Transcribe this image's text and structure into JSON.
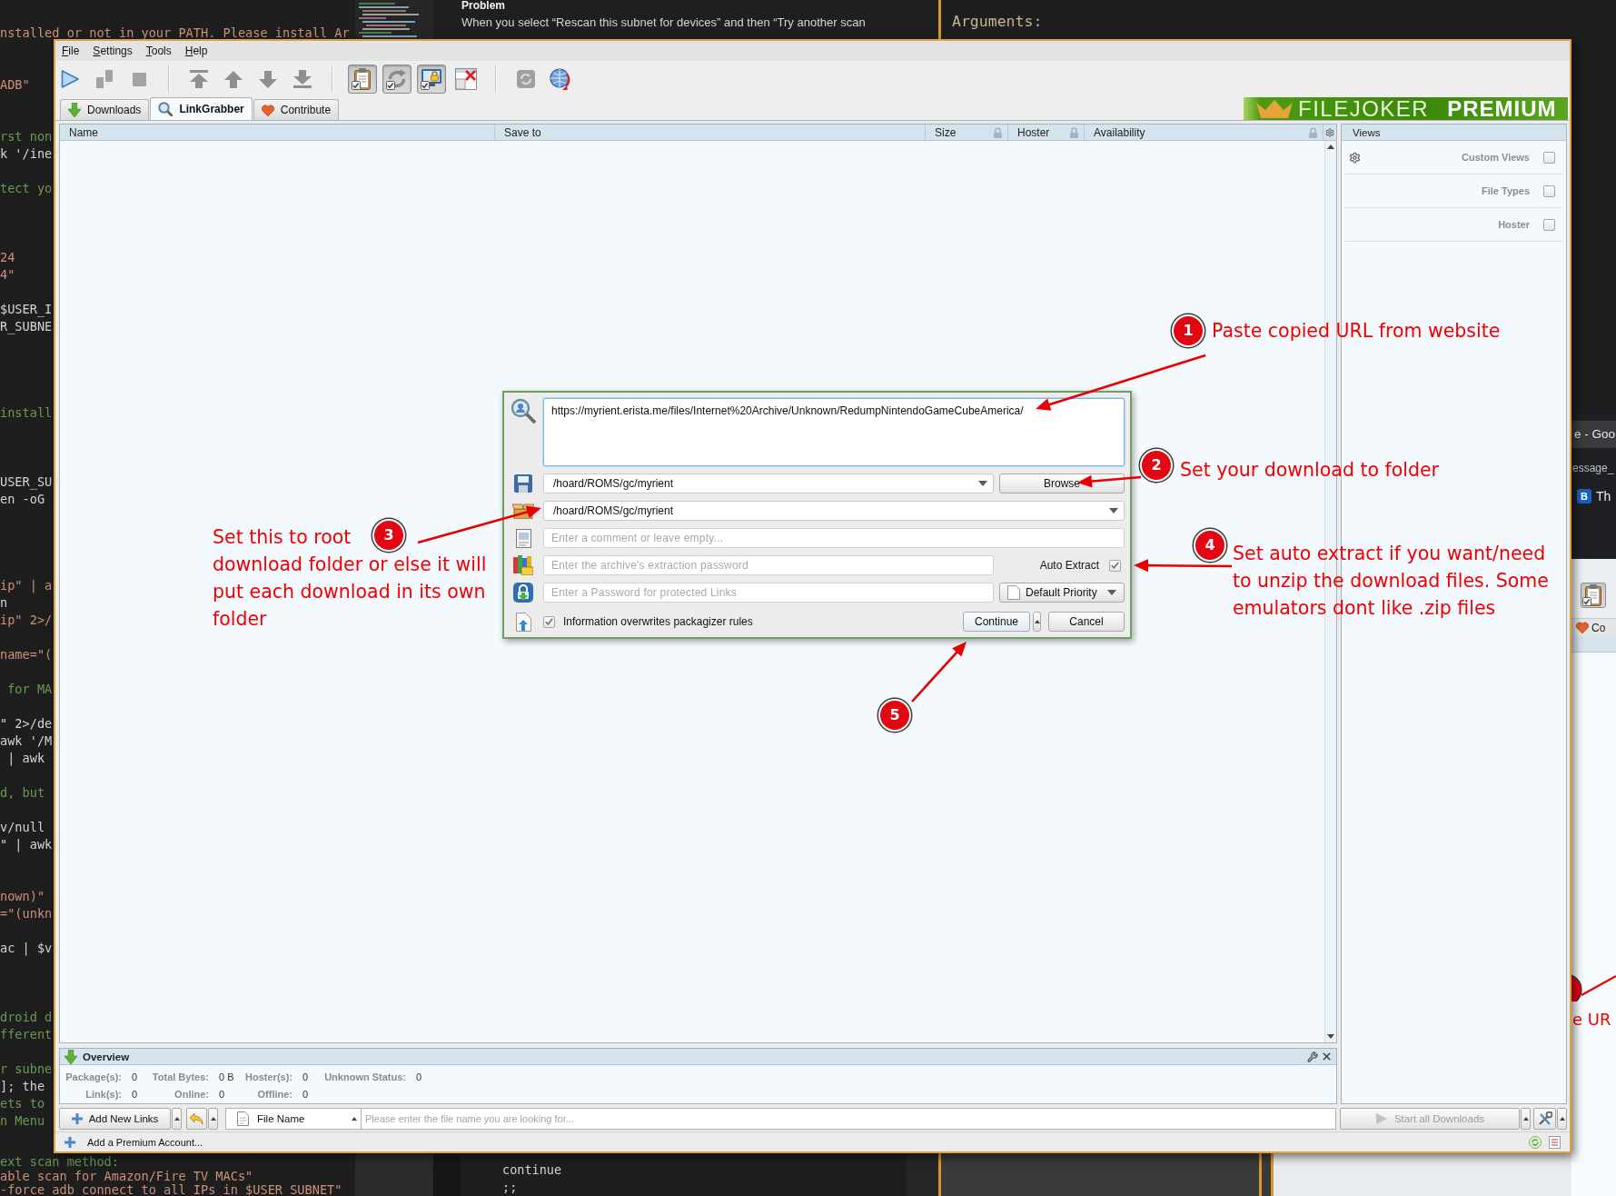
{
  "desktop": {
    "terminal_lines": [
      {
        "text": "nstalled or not in your PATH. Please install Ar",
        "kind": "string"
      },
      {
        "text": "ADB\"",
        "kind": "string"
      },
      {
        "text": "rst non",
        "kind": "comment"
      },
      {
        "text": "k '/ine",
        "kind": "code"
      },
      {
        "text": "tect yo",
        "kind": "comment"
      },
      {
        "text": "24",
        "kind": "string"
      },
      {
        "text": "4\"",
        "kind": "string"
      },
      {
        "text": "$USER_I",
        "kind": "code"
      },
      {
        "text": "R_SUBNE",
        "kind": "code"
      },
      {
        "text": "install",
        "kind": "comment"
      },
      {
        "text": "USER_SU",
        "kind": "code"
      },
      {
        "text": "en -oG",
        "kind": "code"
      },
      {
        "text": "ip\" | a",
        "kind": "string"
      },
      {
        "text": "n",
        "kind": "code"
      },
      {
        "text": "ip\" 2>/",
        "kind": "string"
      },
      {
        "text": "name=\"(",
        "kind": "string"
      },
      {
        "text": " for MA",
        "kind": "comment"
      },
      {
        "text": "\" 2>/de",
        "kind": "code"
      },
      {
        "text": "awk '/M",
        "kind": "code"
      },
      {
        "text": " | awk",
        "kind": "code"
      },
      {
        "text": "d, but",
        "kind": "comment"
      },
      {
        "text": "v/null",
        "kind": "code"
      },
      {
        "text": "\" | awk",
        "kind": "code"
      },
      {
        "text": "nown)\"",
        "kind": "string"
      },
      {
        "text": "=\"(unkn",
        "kind": "string"
      },
      {
        "text": "ac | $v",
        "kind": "code"
      },
      {
        "text": "droid d",
        "kind": "comment"
      },
      {
        "text": "fferent",
        "kind": "comment"
      },
      {
        "text": "r subne",
        "kind": "comment"
      },
      {
        "text": "]; the",
        "kind": "code"
      },
      {
        "text": "ets to",
        "kind": "comment"
      },
      {
        "text": "n Menu",
        "kind": "comment"
      },
      {
        "text": "ext scan method:",
        "kind": "comment"
      },
      {
        "text": "able scan for Amazon/Fire TV MACs\"",
        "kind": "string"
      },
      {
        "text": "-force adb connect to all IPs in $USER_SUBNET\"",
        "kind": "string"
      }
    ],
    "editor_pane": {
      "heading": "Problem",
      "text": "When you select “Rescan this subnet for devices” and then “Try another scan"
    },
    "help_pane": {
      "heading": "Arguments:"
    },
    "browser": {
      "tab_title": "e - Goo",
      "address": "essage_",
      "bookmark_badge": "B",
      "bookmark": "Th"
    },
    "side_app": {
      "tab": "Co",
      "note": "e UR"
    },
    "code_lines": [
      "continue",
      ";;"
    ]
  },
  "app": {
    "menu": [
      "File",
      "Settings",
      "Tools",
      "Help"
    ],
    "toolbar_groups": [
      {
        "buttons": [
          {
            "kind": "start",
            "pressed": false
          },
          {
            "kind": "pause",
            "pressed": false
          },
          {
            "kind": "stop",
            "pressed": false
          }
        ]
      },
      {
        "buttons": [
          {
            "kind": "move_top",
            "pressed": false
          },
          {
            "kind": "move_up",
            "pressed": false
          },
          {
            "kind": "move_down",
            "pressed": false
          },
          {
            "kind": "move_bottom",
            "pressed": false
          }
        ]
      },
      {
        "buttons": [
          {
            "kind": "clipboard",
            "pressed": true
          },
          {
            "kind": "auto_reconnect",
            "pressed": true
          },
          {
            "kind": "premium",
            "pressed": true
          },
          {
            "kind": "silent",
            "pressed": false
          }
        ]
      },
      {
        "buttons": [
          {
            "kind": "reconnect",
            "pressed": false
          },
          {
            "kind": "update",
            "pressed": false
          }
        ]
      }
    ],
    "tabs": [
      {
        "kind": "downloads",
        "label": "Downloads",
        "selected": false
      },
      {
        "kind": "linkgrabber",
        "label": "LinkGrabber",
        "selected": true
      },
      {
        "kind": "contribute",
        "label": "Contribute",
        "selected": false
      }
    ],
    "banner": {
      "brand": "FILEJOKER",
      "tier": "PREMIUM"
    },
    "table": {
      "columns": [
        {
          "label": "Name",
          "locked": false
        },
        {
          "label": "Save to",
          "locked": false
        },
        {
          "label": "Size",
          "locked": true
        },
        {
          "label": "Hoster",
          "locked": true
        },
        {
          "label": "Availability",
          "locked": true
        }
      ]
    },
    "views": {
      "title": "Views",
      "filters": [
        {
          "label": "Custom Views",
          "checked": false
        },
        {
          "label": "File Types",
          "checked": false
        },
        {
          "label": "Hoster",
          "checked": false
        }
      ]
    },
    "overview": {
      "title": "Overview",
      "rows": [
        {
          "stats": [
            {
              "label": "Package(s):",
              "value": "0"
            },
            {
              "label": "Total Bytes:",
              "value": "0 B"
            },
            {
              "label": "Hoster(s):",
              "value": "0"
            },
            {
              "label": "Unknown Status:",
              "value": "0"
            }
          ]
        },
        {
          "stats": [
            {
              "label": "Link(s):",
              "value": "0"
            },
            {
              "label": "Online:",
              "value": "0"
            },
            {
              "label": "Offline:",
              "value": "0"
            }
          ]
        }
      ]
    },
    "bottom_bar": {
      "add_links": "Add New Links",
      "search_scope": "File Name",
      "search_placeholder": "Please enter the file name you are looking for...",
      "start_all": {
        "label": "Start all Downloads",
        "disabled": true
      }
    },
    "status_bar": {
      "add_account": "Add a Premium Account..."
    }
  },
  "dialog": {
    "url": "https://myrient.erista.me/files/Internet%20Archive/Unknown/RedumpNintendoGameCubeAmerica/",
    "save_to": "/hoard/ROMS/gc/myrient",
    "browse": "Browse",
    "package_name": "/hoard/ROMS/gc/myrient",
    "comment": {
      "placeholder": "Enter a comment or leave empty..."
    },
    "extract_password": {
      "placeholder": "Enter the archive's extraction password"
    },
    "auto_extract": {
      "label": "Auto Extract",
      "checked": true
    },
    "links_password": {
      "placeholder": "Enter a Password for protected Links"
    },
    "priority": "Default Priority",
    "overwrite": {
      "label": "Information overwrites packagizer rules",
      "checked": true
    },
    "continue": "Continue",
    "cancel": "Cancel"
  },
  "annotations": [
    {
      "number": "1",
      "lines": [
        "Paste copied URL from website"
      ]
    },
    {
      "number": "2",
      "lines": [
        "Set your download to folder"
      ]
    },
    {
      "number": "3",
      "lines": [
        "Set this to root",
        "download folder or else it will",
        "put each download in its own",
        "folder"
      ]
    },
    {
      "number": "4",
      "lines": [
        "Set auto extract if you want/need",
        "to unzip the download files. Some",
        "emulators dont like .zip files"
      ]
    },
    {
      "number": "5"
    }
  ]
}
